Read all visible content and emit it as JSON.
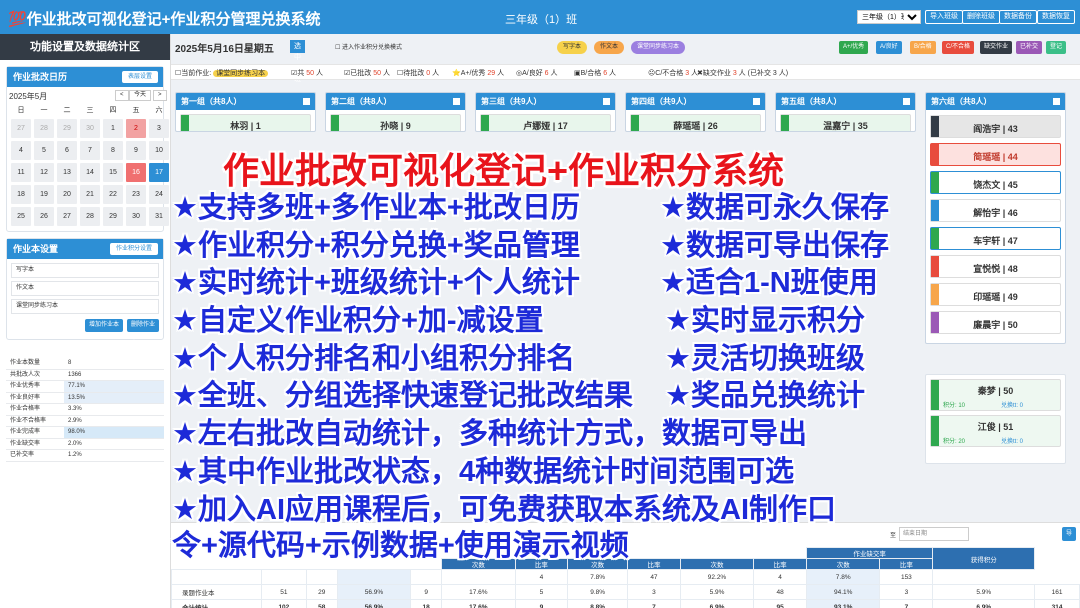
{
  "header": {
    "title": "💯作业批改可视化登记+作业积分管理兑换系统",
    "class_name": "三年级（1）班",
    "class_select": "三年级（1）班",
    "buttons": [
      "导入班级",
      "删除班级",
      "数据备份",
      "数据恢复"
    ]
  },
  "sidebar": {
    "title": "功能设置及数据统计区",
    "calendar": {
      "title": "作业批改日历",
      "settings_btn": "表层设置",
      "month": "2025年5月",
      "prev": "<",
      "today": "今天",
      "next": ">",
      "weekdays": [
        "日",
        "一",
        "二",
        "三",
        "四",
        "五",
        "六"
      ],
      "days": [
        {
          "d": "27",
          "s": "dim"
        },
        {
          "d": "28",
          "s": "dim"
        },
        {
          "d": "29",
          "s": "dim"
        },
        {
          "d": "30",
          "s": "dim"
        },
        {
          "d": "1",
          "s": ""
        },
        {
          "d": "2",
          "s": "mark"
        },
        {
          "d": "3",
          "s": ""
        },
        {
          "d": "4",
          "s": ""
        },
        {
          "d": "5",
          "s": ""
        },
        {
          "d": "6",
          "s": ""
        },
        {
          "d": "7",
          "s": ""
        },
        {
          "d": "8",
          "s": ""
        },
        {
          "d": "9",
          "s": ""
        },
        {
          "d": "10",
          "s": ""
        },
        {
          "d": "11",
          "s": ""
        },
        {
          "d": "12",
          "s": ""
        },
        {
          "d": "13",
          "s": ""
        },
        {
          "d": "14",
          "s": ""
        },
        {
          "d": "15",
          "s": ""
        },
        {
          "d": "16",
          "s": "red"
        },
        {
          "d": "17",
          "s": "today"
        },
        {
          "d": "18",
          "s": ""
        },
        {
          "d": "19",
          "s": ""
        },
        {
          "d": "20",
          "s": ""
        },
        {
          "d": "21",
          "s": ""
        },
        {
          "d": "22",
          "s": ""
        },
        {
          "d": "23",
          "s": ""
        },
        {
          "d": "24",
          "s": ""
        },
        {
          "d": "25",
          "s": ""
        },
        {
          "d": "26",
          "s": ""
        },
        {
          "d": "27",
          "s": ""
        },
        {
          "d": "28",
          "s": ""
        },
        {
          "d": "29",
          "s": ""
        },
        {
          "d": "30",
          "s": ""
        },
        {
          "d": "31",
          "s": ""
        }
      ]
    },
    "books": {
      "title": "作业本设置",
      "settings_btn": "作业积分设置",
      "items": [
        "写字本",
        "作文本",
        "课堂同步练习本"
      ],
      "add_btn": "增加作业本",
      "del_btn": "删除作业本"
    },
    "stats": [
      {
        "k": "作业本数量",
        "v": "8"
      },
      {
        "k": "共批改人次",
        "v": "1366"
      },
      {
        "k": "作业优秀率",
        "v": "77.1%"
      },
      {
        "k": "作业良好率",
        "v": "13.5%"
      },
      {
        "k": "作业合格率",
        "v": "3.3%"
      },
      {
        "k": "作业不合格率",
        "v": "2.9%"
      },
      {
        "k": "作业完成率",
        "v": "98.0%"
      },
      {
        "k": "作业缺交率",
        "v": "2.0%"
      },
      {
        "k": "已补交率",
        "v": "1.2%"
      }
    ]
  },
  "main": {
    "date": "2025年5月16日星期五",
    "select_all": "选中全班",
    "checkbox": "进入作业积分兑换模式",
    "book_tabs": [
      "写字本",
      "作文本",
      "课堂同步练习本"
    ],
    "actions": [
      "A+/优秀",
      "A/良好",
      "B/合格",
      "C/不合格",
      "缺交作业",
      "已补交",
      "登记"
    ],
    "status": {
      "current_label": "当前作业:",
      "current_book": "课堂同步练习本",
      "items": [
        {
          "l": "共",
          "n": "50",
          "u": "人"
        },
        {
          "l": "已批改",
          "n": "50",
          "u": "人"
        },
        {
          "l": "待批改",
          "n": "0",
          "u": "人"
        },
        {
          "l": "A+/优秀",
          "n": "29",
          "u": "人"
        },
        {
          "l": "A/良好",
          "n": "6",
          "u": "人"
        },
        {
          "l": "B/合格",
          "n": "6",
          "u": "人"
        },
        {
          "l": "C/不合格",
          "n": "3",
          "u": "人"
        },
        {
          "l": "缺交作业",
          "n": "3",
          "u": "人 (已补交 3 人)"
        }
      ]
    },
    "groups": [
      {
        "title": "第一组（共8人）",
        "students": [
          "林羽 | 1"
        ]
      },
      {
        "title": "第二组（共8人）",
        "students": [
          "孙晓 | 9"
        ]
      },
      {
        "title": "第三组（共9人）",
        "students": [
          "卢娜娅 | 17"
        ]
      },
      {
        "title": "第四组（共9人）",
        "students": [
          "薛瑶瑶 | 26"
        ]
      },
      {
        "title": "第五组（共8人）",
        "students": [
          "温嘉宁 | 35"
        ]
      },
      {
        "title": "第六组（共8人）",
        "students": [
          "阎浩宇 | 43",
          "简瑶瑶 | 44",
          "饶杰文 | 45",
          "解怡宇 | 46",
          "车宇轩 | 47",
          "宣悦悦 | 48",
          "印瑶瑶 | 49",
          "廉晨宇 | 50"
        ]
      }
    ],
    "extra_students": [
      {
        "name": "秦梦 | 50",
        "score": "积分: 10",
        "exch": "兑换tt: 0"
      },
      {
        "name": "江俊 | 51",
        "score": "积分: 20",
        "exch": "兑换tt: 0"
      }
    ],
    "table": {
      "search_label": "至",
      "search_placeholder": "结束日期",
      "export": "导出统计数据",
      "head2": [
        "作业缺交率",
        "获得积分"
      ],
      "head3": [
        "次数",
        "比率",
        "次数",
        "比率",
        "次数",
        "比率",
        "次数",
        "比率"
      ],
      "rows": [
        [
          "",
          "",
          "",
          "",
          "",
          "",
          "4",
          "7.8%",
          "47",
          "92.2%",
          "4",
          "7.8%",
          "153"
        ],
        [
          "录题作业本",
          "51",
          "29",
          "56.9%",
          "9",
          "17.6%",
          "5",
          "9.8%",
          "3",
          "5.9%",
          "48",
          "94.1%",
          "3",
          "5.9%",
          "161"
        ],
        [
          "合计统计",
          "102",
          "58",
          "56.9%",
          "18",
          "17.6%",
          "9",
          "8.8%",
          "7",
          "6.9%",
          "95",
          "93.1%",
          "7",
          "6.9%",
          "314"
        ]
      ]
    }
  },
  "overlay": {
    "title": "作业批改可视化登记+作业积分系统",
    "left": [
      "★支持多班+多作业本+批改日历",
      "★作业积分+积分兑换+奖品管理",
      "★实时统计+班级统计+个人统计",
      "★自定义作业积分+加-减设置",
      "★个人积分排名和小组积分排名",
      "★全班、分组选择快速登记批改结果",
      "★左右批改自动统计，多种统计方式，数据可导出",
      "★其中作业批改状态，4种数据统计时间范围可选",
      "★加入AI应用课程后，可免费获取本系统及AI制作口",
      "令+源代码+示例数据+使用演示视频"
    ],
    "right": [
      "★数据可永久保存",
      "★数据可导出保存",
      "★适合1-N班使用",
      "★实时显示积分",
      "★灵活切换班级",
      "★奖品兑换统计"
    ]
  },
  "colors": {
    "primary": "#2d8fd5",
    "overlay_red": "#e8141b",
    "overlay_blue": "#1d2ad8",
    "green": "#2fa84f"
  }
}
